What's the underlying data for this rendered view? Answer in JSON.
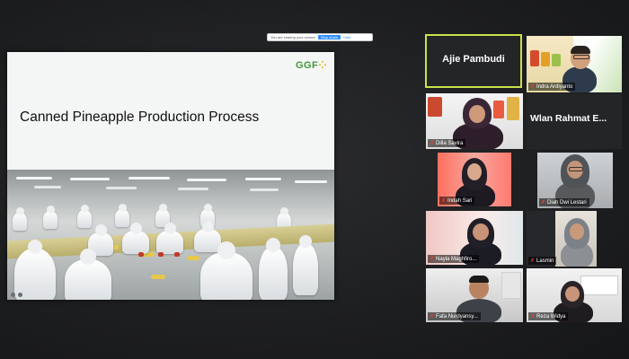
{
  "slide": {
    "logo": "GGF",
    "title": "Canned Pineapple Production Process",
    "share_banner": {
      "text": "You are sharing your screen",
      "stop_label": "Stop share",
      "hide_label": "Hide"
    }
  },
  "participants": [
    {
      "id": "ajie",
      "name": "Ajie Pambudi",
      "display": "name-only",
      "muted": false,
      "active_speaker": true
    },
    {
      "id": "indra",
      "name": "Indra Ardiyanto",
      "display": "video",
      "muted": true,
      "active_speaker": false
    },
    {
      "id": "dilla",
      "name": "Dilla Savira",
      "display": "video",
      "muted": true,
      "active_speaker": false
    },
    {
      "id": "wlan",
      "name": "Wlan Rahmat E...",
      "display": "name-only",
      "muted": false,
      "active_speaker": false
    },
    {
      "id": "indah",
      "name": "Indah Sari",
      "display": "video",
      "muted": true,
      "active_speaker": false
    },
    {
      "id": "diah",
      "name": "Diah Dwi Lestari",
      "display": "video",
      "muted": true,
      "active_speaker": false
    },
    {
      "id": "nayla",
      "name": "Nayla Maghfiro...",
      "display": "video",
      "muted": true,
      "active_speaker": false
    },
    {
      "id": "lasmin",
      "name": "Lasmin",
      "display": "video",
      "muted": true,
      "active_speaker": false
    },
    {
      "id": "fafa",
      "name": "Fafa Nurdyansy...",
      "display": "video",
      "muted": true,
      "active_speaker": false
    },
    {
      "id": "reza",
      "name": "Reza Widya",
      "display": "video",
      "muted": true,
      "active_speaker": false
    }
  ],
  "icons": {
    "muted_mic": "✗"
  },
  "colors": {
    "active_speaker_border": "#c8e24a",
    "muted_icon": "#ff3b30",
    "logo_green": "#3f9b3a"
  }
}
